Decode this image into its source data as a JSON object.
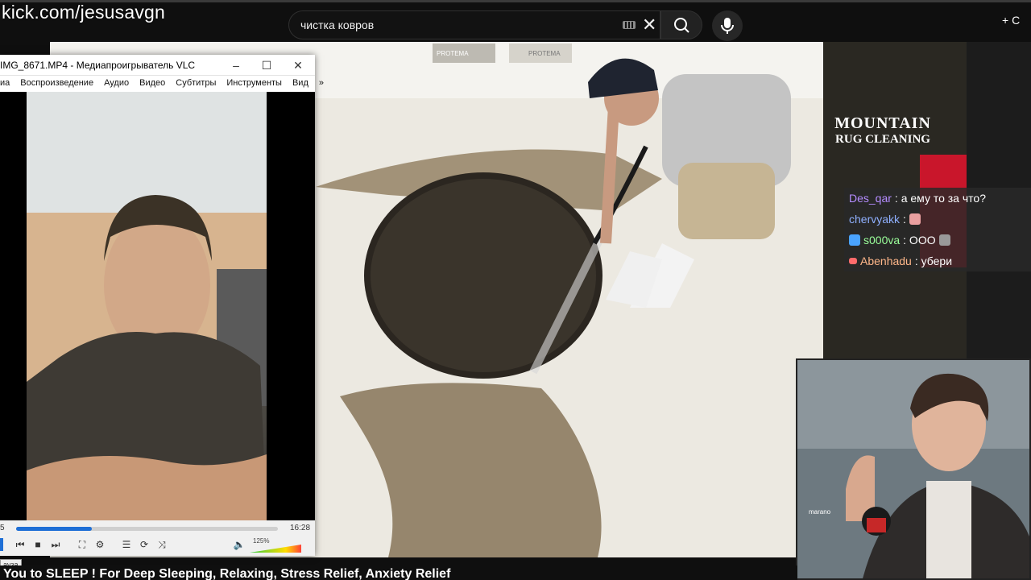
{
  "overlay": {
    "url": "kick.com/jesusavgn"
  },
  "youtube": {
    "search_value": "чистка ковров",
    "create_label": "+ С",
    "video_title": "You to SLEEP ! For Deep Sleeping, Relaxing, Stress Relief, Anxiety Relief"
  },
  "video": {
    "logo_line1": "MOUNTAIN",
    "logo_line2": "RUG CLEANING",
    "machine_label_1": "PROTEMA",
    "machine_label_2": "PROTEMA"
  },
  "chat": [
    {
      "user": "Des_qar",
      "text": ": а ему то за что?",
      "color": "#b48cff"
    },
    {
      "user": "chervyakk",
      "text": ":",
      "color": "#8fb0ff"
    },
    {
      "user": "s000va",
      "text": ": ООО",
      "color": "#9aff9a"
    },
    {
      "user": "Abenhadu",
      "text": ": убери",
      "color": "#ffb78a"
    }
  ],
  "vlc": {
    "title": "IMG_8671.MP4 - Медиапроигрыватель VLC",
    "menu": [
      "иа",
      "Воспроизведение",
      "Аудио",
      "Видео",
      "Субтитры",
      "Инструменты",
      "Вид",
      "»"
    ],
    "time_elapsed": "5",
    "time_total": "16:28",
    "progress": 0.29,
    "volume": "125%",
    "tooltip": "ауза"
  },
  "webcam": {
    "mic_label": "marano"
  }
}
